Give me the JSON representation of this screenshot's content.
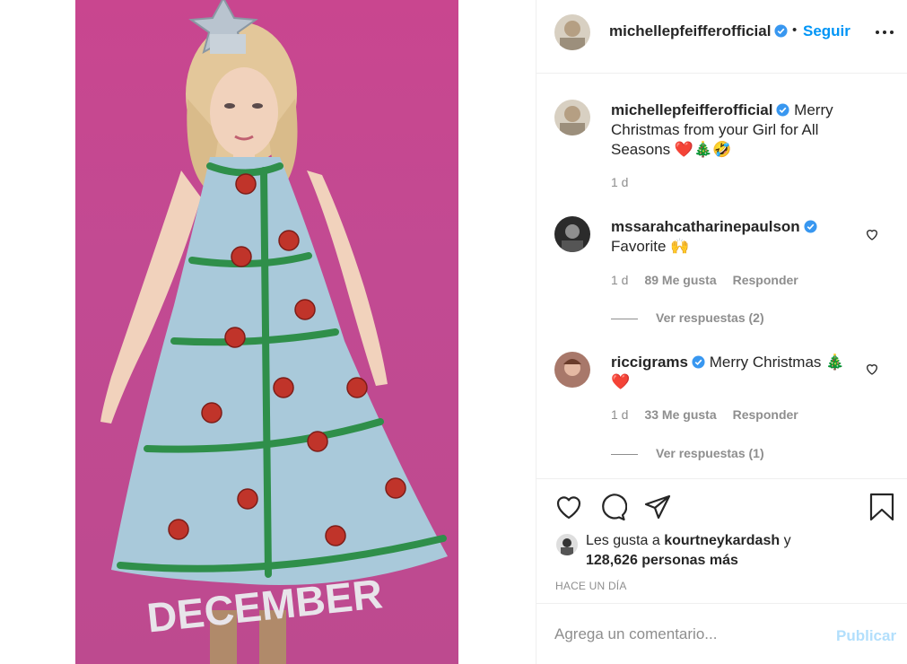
{
  "post": {
    "author": "michellepfeifferofficial",
    "follow_label": "Seguir",
    "separator": "•",
    "photo_text": "DECEMBER"
  },
  "caption": {
    "username": "michellepfeifferofficial",
    "text": "Merry Christmas from your Girl for All Seasons ❤️🎄🤣",
    "time": "1 d"
  },
  "comments": [
    {
      "username": "mssarahcatharinepaulson",
      "text": "Favorite 🙌",
      "time": "1 d",
      "likes": "89 Me gusta",
      "reply_label": "Responder",
      "view_replies": "Ver respuestas (2)"
    },
    {
      "username": "riccigrams",
      "text": "Merry Christmas 🎄❤️",
      "time": "1 d",
      "likes": "33 Me gusta",
      "reply_label": "Responder",
      "view_replies": "Ver respuestas (1)"
    }
  ],
  "likes": {
    "prefix": "Les gusta a",
    "liker": "kourtneykardash",
    "conj": "y",
    "others": "128,626 personas más"
  },
  "posted": "HACE UN DÍA",
  "add_comment": {
    "placeholder": "Agrega un comentario...",
    "publish_label": "Publicar"
  },
  "colors": {
    "accent": "#0095f6",
    "verified": "#3897f0",
    "photo_bg": "#c9468f"
  },
  "icons": [
    "verified-badge-icon",
    "more-options-icon",
    "heart-icon",
    "comment-icon",
    "share-icon",
    "bookmark-icon"
  ]
}
